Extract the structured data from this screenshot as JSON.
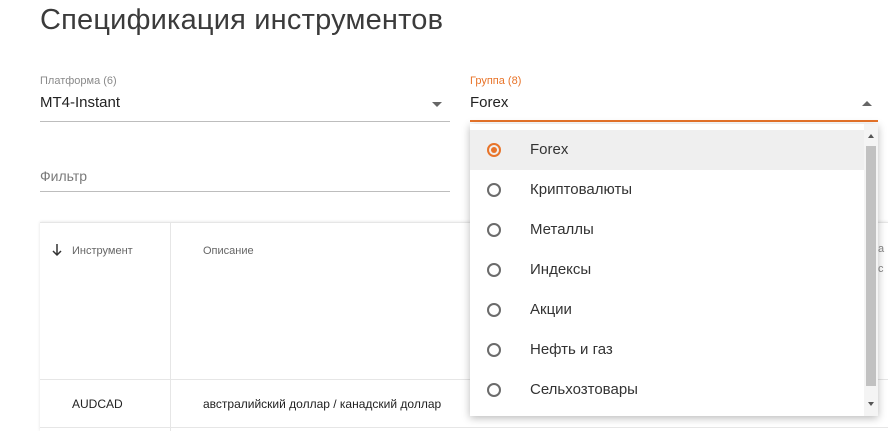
{
  "page": {
    "title": "Спецификация инструментов"
  },
  "platform": {
    "label": "Платформа (6)",
    "value": "MT4-Instant"
  },
  "group": {
    "label": "Группа (8)",
    "value": "Forex",
    "options": [
      {
        "label": "Forex",
        "selected": true
      },
      {
        "label": "Криптовалюты",
        "selected": false
      },
      {
        "label": "Металлы",
        "selected": false
      },
      {
        "label": "Индексы",
        "selected": false
      },
      {
        "label": "Акции",
        "selected": false
      },
      {
        "label": "Нефть и газ",
        "selected": false
      },
      {
        "label": "Сельхозтовары",
        "selected": false
      }
    ]
  },
  "filter": {
    "placeholder": "Фильтр",
    "value": ""
  },
  "table": {
    "columns": [
      "Инструмент",
      "Описание"
    ],
    "sort_icon": "arrow-down-icon",
    "rows": [
      {
        "instrument": "AUDCAD",
        "description": "австралийский доллар / канадский доллар"
      }
    ],
    "cut_header_text": [
      "а",
      "с"
    ]
  },
  "colors": {
    "accent": "#e8742a",
    "text": "#333333",
    "muted": "#8a8a8a"
  },
  "icons": {
    "platform_dropdown": "caret-down-icon",
    "group_dropdown": "caret-up-icon",
    "sort": "arrow-down-icon"
  }
}
